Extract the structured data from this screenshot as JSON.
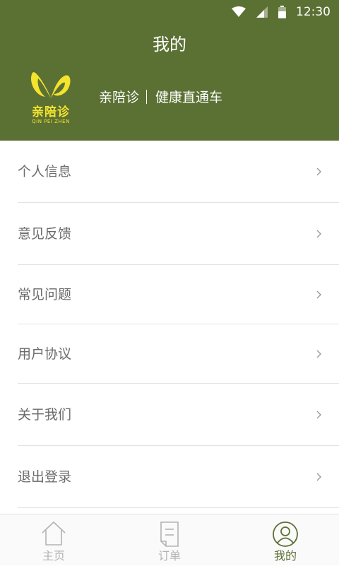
{
  "status_bar": {
    "time": "12:30",
    "icons": [
      "wifi-icon",
      "signal-icon",
      "battery-icon"
    ]
  },
  "header": {
    "title": "我的"
  },
  "logo": {
    "text": "亲陪诊",
    "subtext": "QIN PEI ZHEN"
  },
  "slogan": {
    "brand": "亲陪诊",
    "tagline": "健康直通车"
  },
  "menu": {
    "items": [
      {
        "label": "个人信息"
      },
      {
        "label": "意见反馈"
      },
      {
        "label": "常见问题"
      },
      {
        "label": "用户协议"
      },
      {
        "label": "关于我们"
      },
      {
        "label": "退出登录"
      }
    ]
  },
  "tabbar": {
    "tabs": [
      {
        "label": "主页",
        "icon": "home-icon"
      },
      {
        "label": "订单",
        "icon": "order-icon"
      },
      {
        "label": "我的",
        "icon": "profile-icon",
        "active": true
      }
    ]
  },
  "colors": {
    "brand_green": "#5b7134",
    "logo_yellow": "#f5e32c",
    "text_gray": "#6b6b6b",
    "inactive_tab": "#b3b3b3"
  }
}
